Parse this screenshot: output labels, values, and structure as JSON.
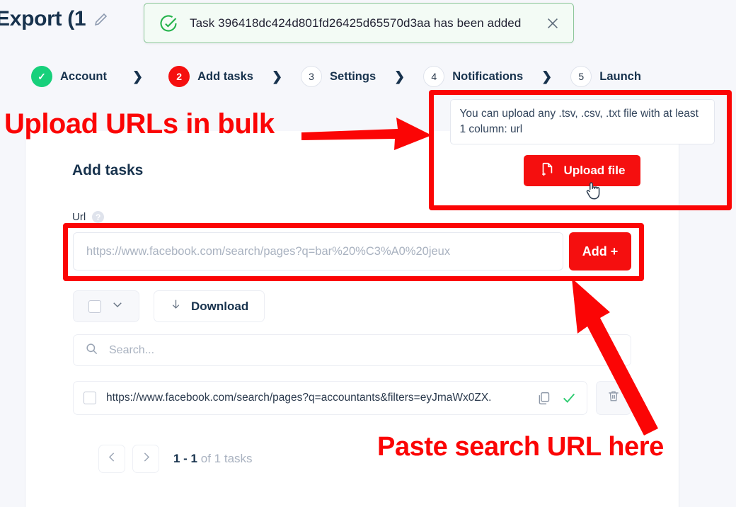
{
  "header": {
    "title": "Export (1",
    "edit_icon": "pencil-icon"
  },
  "toast": {
    "icon": "check-circle-icon",
    "message": "Task 396418dc424d801fd26425d65570d3aa has been added",
    "close_icon": "close-icon",
    "border_color": "#8ec79b",
    "background": "#f3fbf5"
  },
  "stepper": {
    "steps": [
      {
        "badge": "✓",
        "label": "Account",
        "state": "done"
      },
      {
        "badge": "2",
        "label": "Add tasks",
        "state": "active"
      },
      {
        "badge": "3",
        "label": "Settings",
        "state": "todo"
      },
      {
        "badge": "4",
        "label": "Notifications",
        "state": "todo"
      },
      {
        "badge": "5",
        "label": "Launch",
        "state": "todo"
      }
    ],
    "separator": "❯",
    "done_color": "#17d07b",
    "active_color": "#f50f0f"
  },
  "upload": {
    "hint": "You can upload any .tsv, .csv, .txt file with at least 1 column: url",
    "button_label": "Upload file",
    "button_icon": "file-plus-icon",
    "button_color": "#f50f0f",
    "cursor_icon": "pointing-hand-cursor"
  },
  "form": {
    "section_title": "Add tasks",
    "url_label": "Url",
    "help_icon": "question-mark-icon",
    "url_value": "",
    "url_placeholder": "https://www.facebook.com/search/pages?q=bar%20%C3%A0%20jeux",
    "add_button_label": "Add +"
  },
  "toolbar": {
    "select_all_icon": "checkbox-icon",
    "select_all_caret_icon": "chevron-down-icon",
    "download_label": "Download",
    "download_icon": "download-arrow-icon"
  },
  "search": {
    "icon": "search-icon",
    "value": "",
    "placeholder": "Search..."
  },
  "tasks": {
    "rows": [
      {
        "checkbox_icon": "checkbox-icon",
        "url": "https://www.facebook.com/search/pages?q=accountants&filters=eyJmaWx0ZX.",
        "copy_icon": "copy-icon",
        "status_icon": "check-icon",
        "status_color": "#2ecc71",
        "delete_icon": "trash-icon"
      }
    ]
  },
  "pagination": {
    "prev_icon": "chevron-left-icon",
    "next_icon": "chevron-right-icon",
    "range": "1 - 1",
    "total_text": "of 1 tasks"
  },
  "annotations": {
    "color": "#fb0505",
    "upload_text": "Upload URLs in bulk",
    "paste_text": "Paste search URL here",
    "upload_arrow_icon": "arrow-right-icon",
    "paste_arrow_icon": "arrow-up-left-icon"
  }
}
